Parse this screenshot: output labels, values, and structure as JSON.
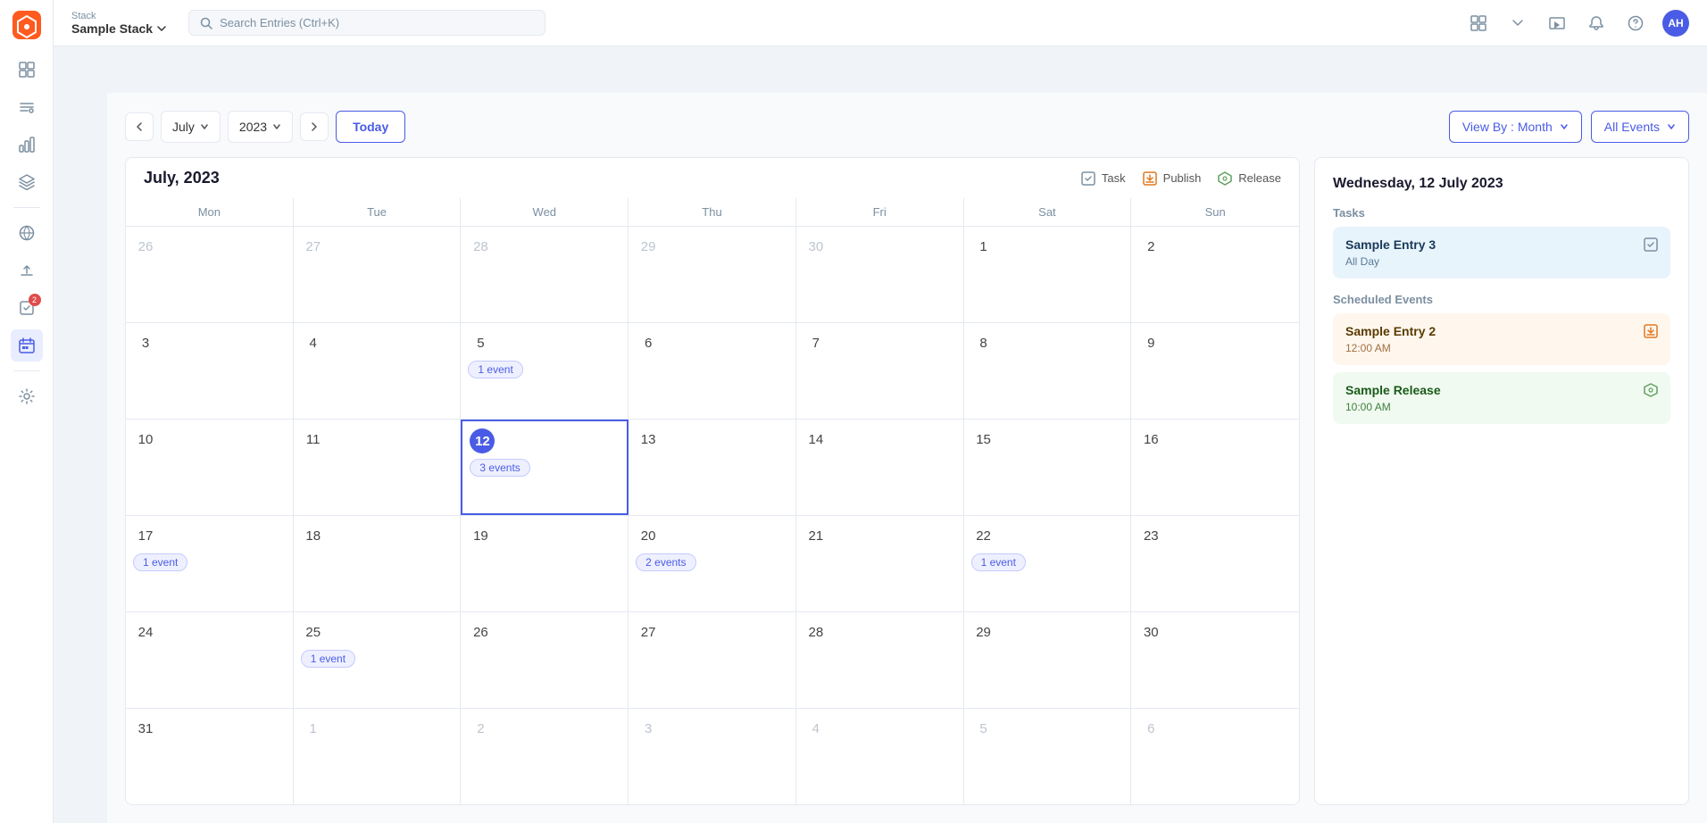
{
  "app": {
    "stack_label": "Stack",
    "stack_title": "Sample Stack",
    "search_placeholder": "Search Entries (Ctrl+K)",
    "avatar": "AH"
  },
  "topbar": {
    "view_toggle_icon": "grid-icon",
    "chevron_icon": "chevron-down-icon"
  },
  "sidebar": {
    "items": [
      {
        "id": "dashboard",
        "label": "Dashboard"
      },
      {
        "id": "list",
        "label": "List View"
      },
      {
        "id": "chart",
        "label": "Chart"
      },
      {
        "id": "layers",
        "label": "Layers"
      },
      {
        "id": "divider1",
        "type": "divider"
      },
      {
        "id": "network",
        "label": "Network"
      },
      {
        "id": "upload",
        "label": "Upload"
      },
      {
        "id": "tasks",
        "label": "Tasks",
        "badge": "2"
      },
      {
        "id": "calendar",
        "label": "Calendar",
        "active": true
      },
      {
        "id": "divider2",
        "type": "divider"
      },
      {
        "id": "settings",
        "label": "Settings"
      }
    ]
  },
  "calendar": {
    "title": "July, 2023",
    "month_label": "July",
    "year_label": "2023",
    "today_label": "Today",
    "view_by_label": "View By : Month",
    "all_events_label": "All Events",
    "days_of_week": [
      "Mon",
      "Tue",
      "Wed",
      "Thu",
      "Fri",
      "Sat",
      "Sun"
    ],
    "legend": {
      "task_label": "Task",
      "publish_label": "Publish",
      "release_label": "Release"
    },
    "weeks": [
      [
        {
          "num": "26",
          "other": true
        },
        {
          "num": "27",
          "other": true
        },
        {
          "num": "28",
          "other": true
        },
        {
          "num": "29",
          "other": true
        },
        {
          "num": "30",
          "other": true
        },
        {
          "num": "1"
        },
        {
          "num": "2"
        }
      ],
      [
        {
          "num": "3"
        },
        {
          "num": "4"
        },
        {
          "num": "5",
          "events": "1 event"
        },
        {
          "num": "6"
        },
        {
          "num": "7"
        },
        {
          "num": "8"
        },
        {
          "num": "9"
        }
      ],
      [
        {
          "num": "10"
        },
        {
          "num": "11"
        },
        {
          "num": "12",
          "today": true,
          "events": "3 events",
          "selected": true
        },
        {
          "num": "13"
        },
        {
          "num": "14"
        },
        {
          "num": "15"
        },
        {
          "num": "16"
        }
      ],
      [
        {
          "num": "17",
          "events": "1 event"
        },
        {
          "num": "18"
        },
        {
          "num": "19"
        },
        {
          "num": "20",
          "events": "2 events"
        },
        {
          "num": "21"
        },
        {
          "num": "22",
          "events": "1 event"
        },
        {
          "num": "23"
        }
      ],
      [
        {
          "num": "24"
        },
        {
          "num": "25",
          "events": "1 event"
        },
        {
          "num": "26"
        },
        {
          "num": "27"
        },
        {
          "num": "28"
        },
        {
          "num": "29"
        },
        {
          "num": "30"
        }
      ],
      [
        {
          "num": "31"
        },
        {
          "num": "1",
          "other": true
        },
        {
          "num": "2",
          "other": true
        },
        {
          "num": "3",
          "other": true
        },
        {
          "num": "4",
          "other": true
        },
        {
          "num": "5",
          "other": true
        },
        {
          "num": "6",
          "other": true
        }
      ]
    ]
  },
  "side_panel": {
    "date_label": "Wednesday, 12 July 2023",
    "tasks_section": "Tasks",
    "task1": {
      "title": "Sample Entry 3",
      "subtitle": "All Day"
    },
    "scheduled_section": "Scheduled Events",
    "event1": {
      "title": "Sample Entry 2",
      "time": "12:00 AM",
      "type": "publish"
    },
    "event2": {
      "title": "Sample Release",
      "time": "10:00 AM",
      "type": "release"
    }
  }
}
